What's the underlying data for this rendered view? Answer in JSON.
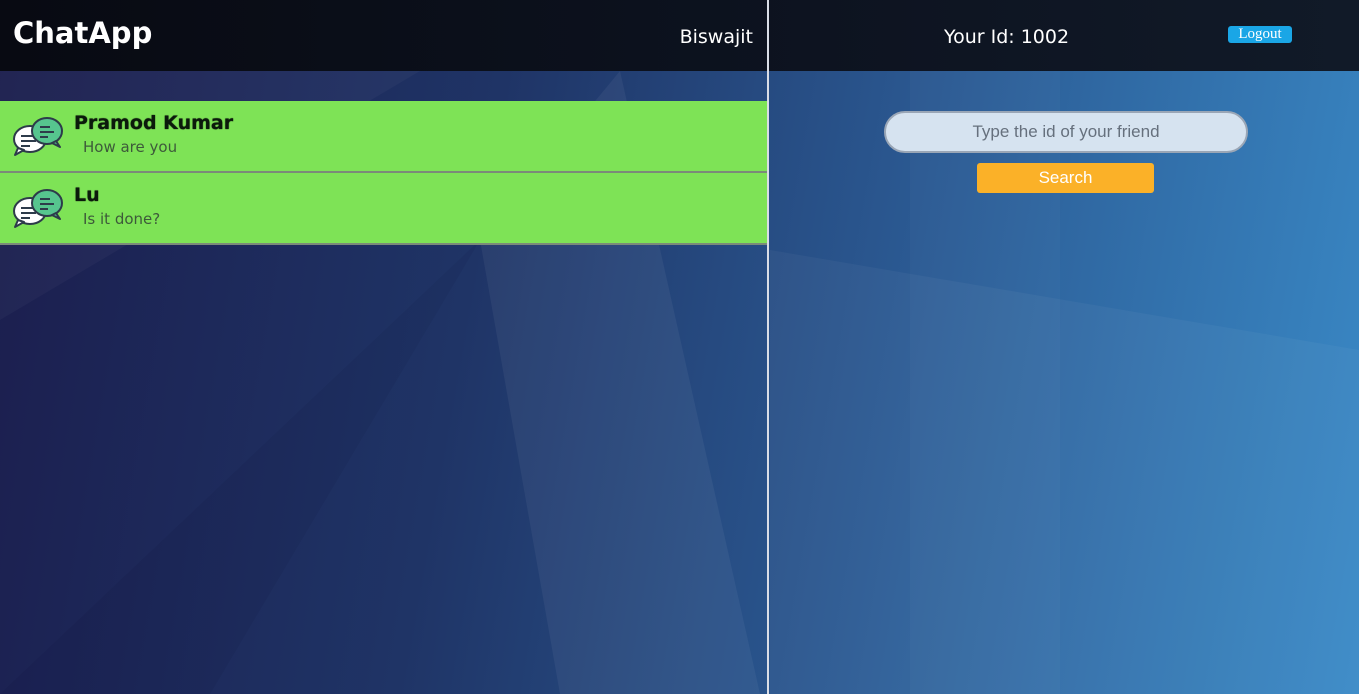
{
  "header": {
    "brand": "ChatApp",
    "username": "Biswajit",
    "user_id_text": "Your Id: 1002",
    "logout_label": "Logout"
  },
  "chats": [
    {
      "name": "Pramod Kumar",
      "last_message": "How are you",
      "icon": "chat-bubbles-icon"
    },
    {
      "name": "Lu",
      "last_message": "Is it done?",
      "icon": "chat-bubbles-icon"
    }
  ],
  "search": {
    "placeholder": "Type the id of your friend",
    "value": "",
    "button_label": "Search"
  },
  "colors": {
    "topbar": "#0b0f18",
    "chat_item": "#7de352",
    "search_button": "#fbb128",
    "logout_button": "#1aa6e6"
  }
}
